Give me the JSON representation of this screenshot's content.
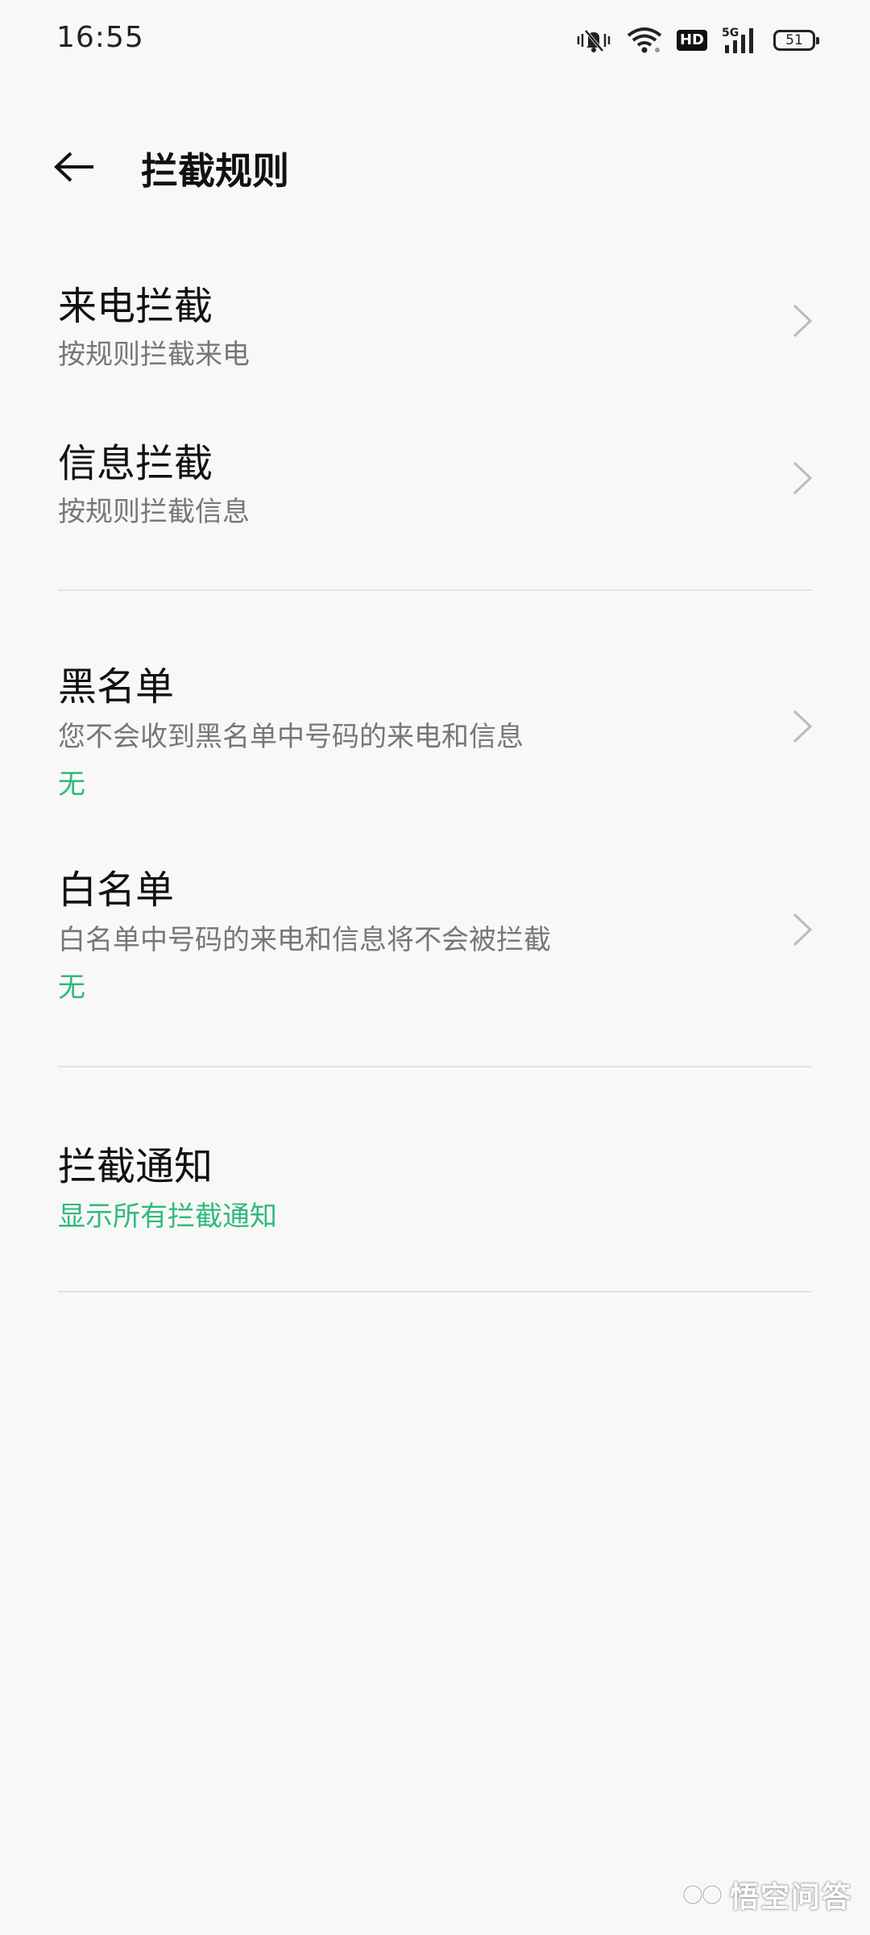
{
  "status_bar": {
    "time": "16:55",
    "network": "5G",
    "hd_label": "HD",
    "battery": "51"
  },
  "header": {
    "title": "拦截规则"
  },
  "sections": {
    "call_block": {
      "title": "来电拦截",
      "subtitle": "按规则拦截来电"
    },
    "sms_block": {
      "title": "信息拦截",
      "subtitle": "按规则拦截信息"
    },
    "blacklist": {
      "title": "黑名单",
      "subtitle": "您不会收到黑名单中号码的来电和信息",
      "value": "无"
    },
    "whitelist": {
      "title": "白名单",
      "subtitle": "白名单中号码的来电和信息将不会被拦截",
      "value": "无"
    },
    "notification": {
      "title": "拦截通知",
      "value": "显示所有拦截通知"
    }
  },
  "watermark": {
    "text": "悟空问答"
  },
  "colors": {
    "accent": "#2fba7c",
    "background": "#f8f8f8",
    "divider": "#e2e2e2"
  },
  "icons": [
    "mute-vibrate-icon",
    "wifi-icon",
    "hd-icon",
    "signal-5g-icon",
    "battery-icon",
    "back-arrow-icon",
    "chevron-right-icon"
  ]
}
